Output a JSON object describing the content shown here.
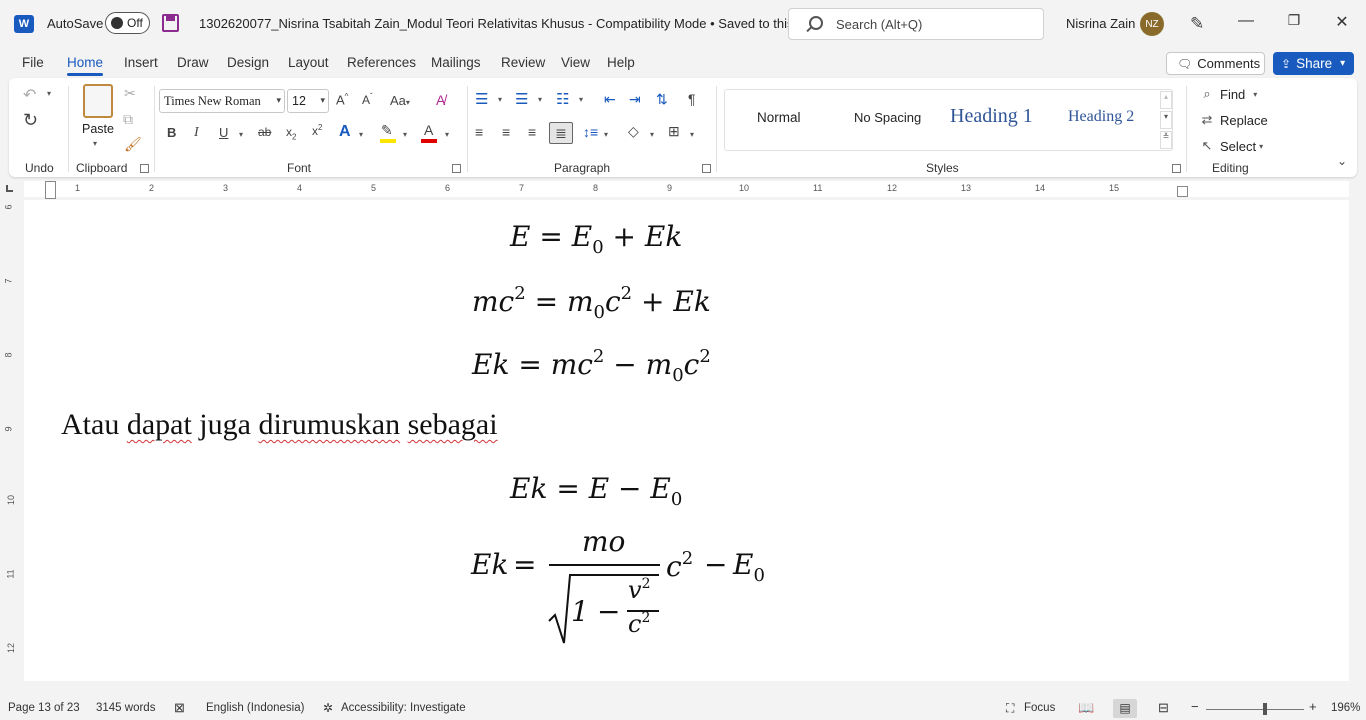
{
  "titlebar": {
    "autosave_label": "AutoSave",
    "autosave_state": "Off",
    "document_title": "1302620077_Nisrina Tsabitah Zain_Modul Teori Relativitas Khusus  -  Compatibility Mode • Saved to this PC",
    "search_placeholder": "Search (Alt+Q)",
    "user_name": "Nisrina Zain",
    "user_initials": "NZ"
  },
  "menu": {
    "tabs": [
      "File",
      "Home",
      "Insert",
      "Draw",
      "Design",
      "Layout",
      "References",
      "Mailings",
      "Review",
      "View",
      "Help"
    ],
    "active_tab": "Home",
    "comments_label": "Comments",
    "share_label": "Share"
  },
  "ribbon": {
    "groups": {
      "undo": "Undo",
      "clipboard": "Clipboard",
      "font": "Font",
      "paragraph": "Paragraph",
      "styles": "Styles",
      "editing": "Editing"
    },
    "paste_label": "Paste",
    "font_name": "Times New Roman",
    "font_size": "12",
    "styles": [
      "Normal",
      "No Spacing",
      "Heading 1",
      "Heading 2"
    ],
    "editing": {
      "find": "Find",
      "replace": "Replace",
      "select": "Select"
    },
    "colors": {
      "highlight": "#ffe600",
      "font_color": "#e00000",
      "accent": "#185abd"
    }
  },
  "ruler": {
    "horizontal": [
      "1",
      "2",
      "3",
      "4",
      "5",
      "6",
      "7",
      "8",
      "9",
      "10",
      "11",
      "12",
      "13",
      "14",
      "15"
    ],
    "vertical": [
      "6",
      "7",
      "8",
      "9",
      "10",
      "11",
      "12"
    ]
  },
  "document": {
    "paragraph_words": [
      "Atau",
      "dapat",
      "juga",
      "dirumuskan",
      "sebagai"
    ],
    "eq1": {
      "lhs": "E",
      "eq": "=",
      "e": "E",
      "sub0": "0",
      "plus": "+",
      "ek": "Ek"
    },
    "eq2": {
      "m": "mc",
      "exp": "2",
      "eq": "=",
      "m0": "m",
      "sub0": "0",
      "c": "c",
      "exp2": "2",
      "plus": "+",
      "ek": "Ek"
    },
    "eq3": {
      "ek": "Ek",
      "eq": "=",
      "m": "mc",
      "exp": "2",
      "minus": "−",
      "m0": "m",
      "sub0": "0",
      "c": "c",
      "exp2": "2"
    },
    "eq4": {
      "ek": "Ek",
      "eq": "=",
      "e": "E",
      "minus": "−",
      "e0": "E",
      "sub0": "0"
    },
    "eq5": {
      "ek": "Ek",
      "eq": "=",
      "num": "mo",
      "one": "1",
      "minus": "−",
      "v": "v",
      "c": "c",
      "exp": "2",
      "trail_c": "c",
      "minus2": "−",
      "e0": "E",
      "sub0": "0"
    }
  },
  "status": {
    "page": "Page 13 of 23",
    "words": "3145 words",
    "language": "English (Indonesia)",
    "accessibility": "Accessibility: Investigate",
    "focus": "Focus",
    "zoom": "196%"
  }
}
